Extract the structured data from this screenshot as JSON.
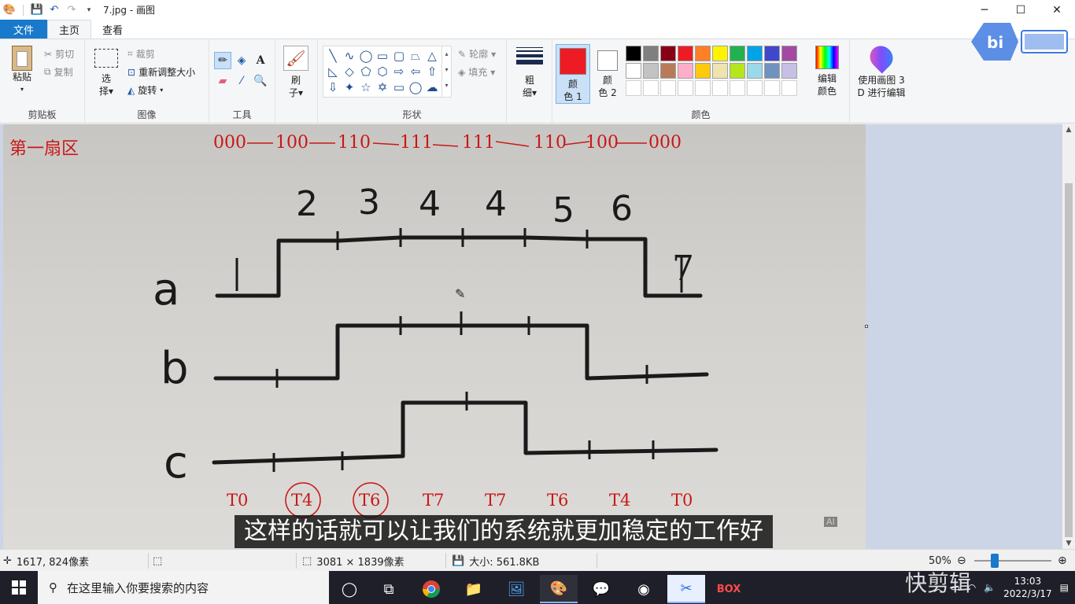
{
  "titlebar": {
    "title": "7.jpg - 画图",
    "minimize_icon": "minimize-icon",
    "maximize_icon": "maximize-icon",
    "close_icon": "close-icon"
  },
  "tabs": [
    {
      "label": "文件"
    },
    {
      "label": "主页"
    },
    {
      "label": "查看"
    }
  ],
  "ribbon": {
    "clipboard": {
      "paste": "粘贴",
      "cut": "剪切",
      "copy": "复制",
      "group": "剪贴板"
    },
    "image": {
      "select_1": "选",
      "select_2": "择",
      "crop": "裁剪",
      "resize": "重新调整大小",
      "rotate": "旋转",
      "group": "图像"
    },
    "tools": {
      "group": "工具"
    },
    "brush": {
      "label_1": "刷",
      "label_2": "子"
    },
    "shapes": {
      "outline": "轮廓",
      "fill": "填充",
      "group": "形状"
    },
    "size": {
      "label_1": "粗",
      "label_2": "细"
    },
    "color1": {
      "label_1": "颜",
      "label_2": "色 1",
      "value": "#ed1c24"
    },
    "color2": {
      "label_1": "颜",
      "label_2": "色 2",
      "value": "#ffffff"
    },
    "colors": {
      "group": "颜色",
      "edit_1": "编辑",
      "edit_2": "颜色"
    },
    "paint3d": {
      "label_1": "使用画图 3",
      "label_2": "D 进行编辑"
    },
    "palette_row1": [
      "#000000",
      "#7f7f7f",
      "#880015",
      "#ed1c24",
      "#ff7f27",
      "#fff200",
      "#22b14c",
      "#00a2e8",
      "#3f48cc",
      "#a349a4"
    ],
    "palette_row2": [
      "#ffffff",
      "#c3c3c3",
      "#b97a57",
      "#ffaec9",
      "#ffc90e",
      "#efe4b0",
      "#b5e61d",
      "#99d9ea",
      "#7092be",
      "#c8bfe7"
    ]
  },
  "canvas": {
    "sector_title": "第一扇区",
    "sequence": [
      "000",
      "100",
      "110",
      "111",
      "111",
      "110",
      "100",
      "000"
    ],
    "segment_numbers": [
      "2",
      "3",
      "4",
      "4",
      "5",
      "6"
    ],
    "edge_labels": [
      "1",
      "7"
    ],
    "signal_labels": [
      "a",
      "b",
      "c"
    ],
    "t_labels": [
      "T0",
      "T4",
      "T6",
      "T7",
      "T7",
      "T6",
      "T4",
      "T0"
    ],
    "subtitle": "这样的话就可以让我们的系统就更加稳定的工作好",
    "ai_badge": "AI"
  },
  "statusbar": {
    "cursor_pos": "1617, 824像素",
    "image_size": "3081 × 1839像素",
    "file_size": "大小: 561.8KB",
    "zoom": "50%"
  },
  "taskbar": {
    "search_placeholder": "在这里输入你要搜索的内容",
    "clock_time": "13:03",
    "clock_date": "2022/3/17",
    "watermark": "快剪辑"
  }
}
